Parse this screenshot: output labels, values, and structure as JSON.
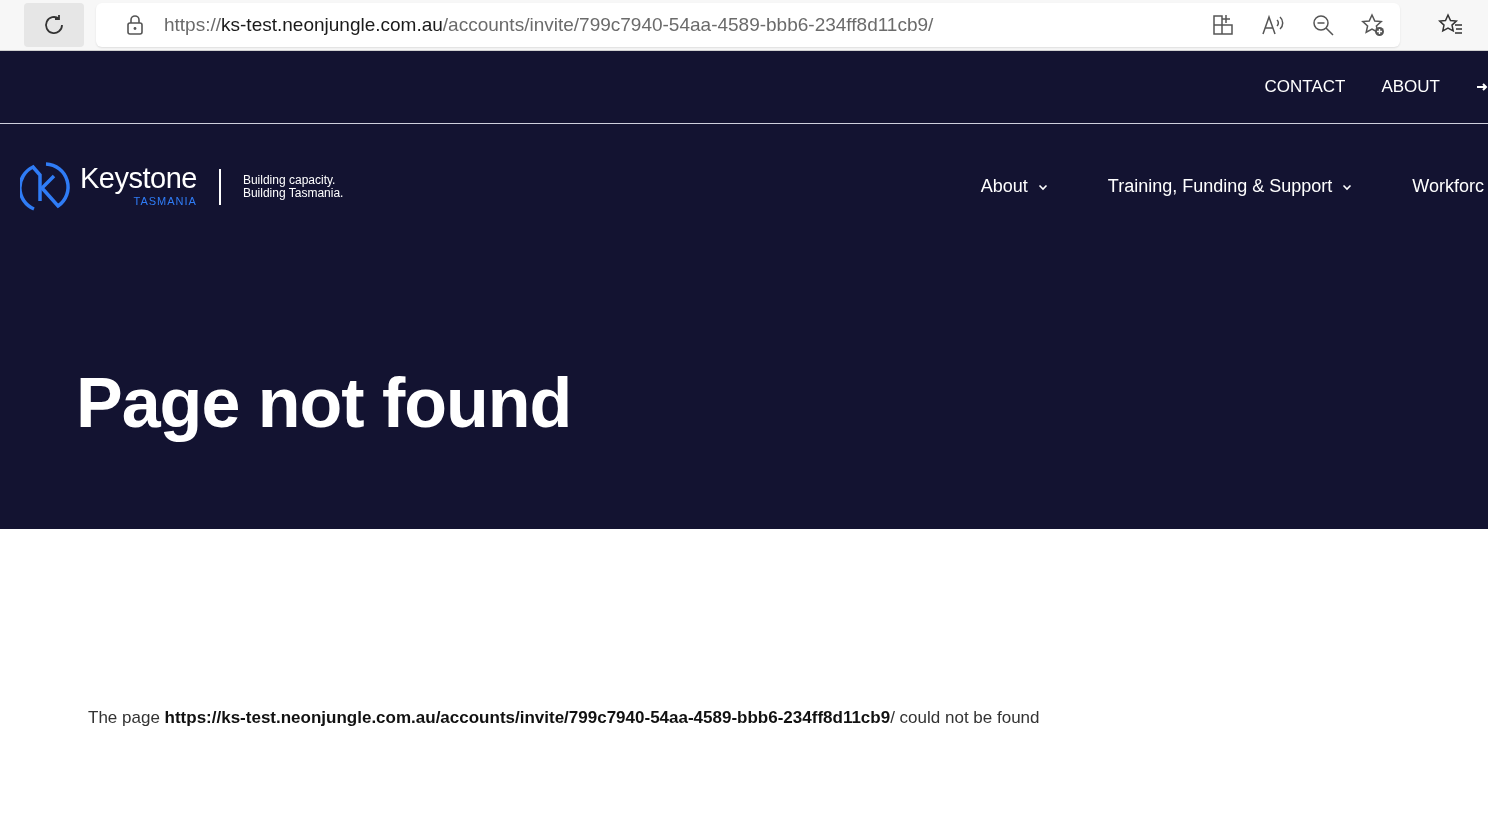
{
  "browser": {
    "url": {
      "scheme": "https://",
      "host": "ks-test.neonjungle.com.au",
      "path": "/accounts/invite/799c7940-54aa-4589-bbb6-234ff8d11cb9/"
    }
  },
  "top_bar": {
    "links": [
      "CONTACT",
      "ABOUT"
    ]
  },
  "header": {
    "logo": {
      "name": "Keystone",
      "region": "TASMANIA",
      "tagline": [
        "Building capacity.",
        "Building Tasmania."
      ]
    },
    "nav": [
      {
        "label": "About",
        "dropdown": true
      },
      {
        "label": "Training, Funding & Support",
        "dropdown": true
      },
      {
        "label": "Workforc",
        "dropdown": false
      }
    ]
  },
  "hero": {
    "title": "Page not found"
  },
  "message": "The page **https://ks-test.neonjungle.com.au/accounts/invite/799c7940-54aa-4589-bbb6-234ff8d11cb9**/ could not be found"
}
